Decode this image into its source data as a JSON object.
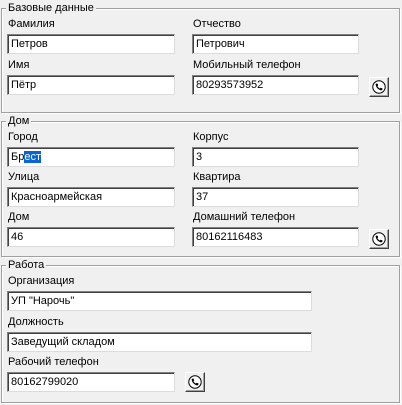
{
  "basic": {
    "title": "Базовые данные",
    "last_name_label": "Фамилия",
    "last_name_value": "Петров",
    "middle_name_label": "Отчество",
    "middle_name_value": "Петрович",
    "first_name_label": "Имя",
    "first_name_value": "Пётр",
    "mobile_label": "Мобильный телефон",
    "mobile_value": "80293573952"
  },
  "home": {
    "title": "Дом",
    "city_label": "Город",
    "city_value_plain": "Бр",
    "city_value_selected": "ест",
    "building_label": "Корпус",
    "building_value": "3",
    "street_label": "Улица",
    "street_value": "Красноармейская",
    "apartment_label": "Квартира",
    "apartment_value": "37",
    "house_label": "Дом",
    "house_value": "46",
    "home_phone_label": "Домашний телефон",
    "home_phone_value": "80162116483"
  },
  "work": {
    "title": "Работа",
    "org_label": "Организация",
    "org_value": "УП \"Нарочь\"",
    "position_label": "Должность",
    "position_value": "Заведущий складом",
    "work_phone_label": "Рабочий телефон",
    "work_phone_value": "80162799020"
  },
  "icons": {
    "phone_button": "phone-icon"
  }
}
